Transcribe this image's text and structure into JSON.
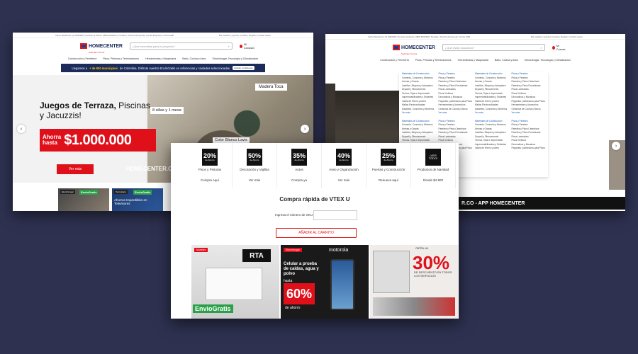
{
  "shot1": {
    "topline_left": "Venta Telefónica: (1) 6003300 | Servicio al cliente: 0800 6003300 | Tiendas | Servicio Empresas | Venta Empresa | Venta SAB",
    "topline_right": "Mis pedidos | Ayuda | Tiendas | Registro | Iniciar sesión",
    "logo": "HOMECENTER",
    "logo_sub": "Sodimac Corona",
    "search_placeholder": "¿Qué necesitas para tu proyecto?",
    "cart_label": "Mi Canasta",
    "nav": [
      "Construcción y Ferretería",
      "Pisos, Pinturas y Terminaciones",
      "Herramientas y Maquinaria",
      "Baño, Cocina y Aseo",
      "Electrohogar, Tecnología y Climatización"
    ],
    "promo_pre": "Llegamos a",
    "promo_highlight": "+ de 800 municipios",
    "promo_post": "de Colombia. Disfruta nuestro EnvíoGratis en referencias y ciudades seleccionadas.",
    "promo_pill": "Aplican condiciones",
    "hero_line1_bold": "Juegos de Terraza,",
    "hero_line1_rest": "Piscinas",
    "hero_line2": "y Jacuzzis!",
    "price_small_1": "Ahorra",
    "price_small_2": "hasta",
    "price_big": "$1.000.000",
    "hero_button": "Ver más",
    "tag_madera": "Madera Toca",
    "tag_sillas": "8 sillas y 1 mesa",
    "tag_color": "Color Blanco Lavis",
    "hero_brand": "HOMECENTER.CO",
    "tiles": [
      {
        "cat": "Electrohogar",
        "badge": "EnvioGratis",
        "text": ""
      },
      {
        "cat": "Tecnología",
        "badge": "EnvioGratis",
        "text": "Ahorros Imperdibles en Televisores"
      }
    ]
  },
  "shot2": {
    "topline_left": "Venta Telefónica: (1) 6003300 | Servicio al cliente: 0800 6003300 | Tiendas | Servicio Empresas | Venta SAB",
    "topline_right": "Mis pedidos | Ayuda | Tiendas | Registro | Iniciar sesión",
    "logo": "HOMECENTER",
    "logo_sub": "Sodimac Corona",
    "search_placeholder": "¿Qué estás buscando?",
    "cart_label": "Mi Cuenta",
    "nav": [
      "Construcción y Ferretería",
      "Pisos, Pinturas y Terminaciones",
      "Herramientas y Maquinaria",
      "Baño, Cocina y Aseo",
      "Electrohogar, Tecnología y Climatización"
    ],
    "menu_cols": [
      {
        "head": "Materiales de Construcción",
        "items": [
          "Cemento, Concreto y Morteros",
          "Arenas y Gravas",
          "Ladrillos, Bloques y Adoquines",
          "Drywall y Fibrocemento",
          "Techos, Tejas e Impermeab.",
          "Impermeabilizantes y Sellantes",
          "Varilla de Hierro y Acero",
          "Mallas Electrosoldadas",
          "Aislantes, Concretos y Morteros"
        ],
        "more": "Ver más"
      },
      {
        "head": "Pisos y Paredes",
        "items": [
          "Pisos y Paredes",
          "Paredes y Pisos Cerámicos",
          "Paredes y Pisos Porcelanato",
          "Pisos Laminados",
          "Pisos Vinílicos",
          "Decorativos y Mosaicos",
          "Pegantes y Adhesivos para Pisos",
          "Herramientas y Accesorios",
          "Cerámica de Cocina y Muros"
        ],
        "more": "Ver más"
      },
      {
        "head": "Materiales de Construcción",
        "items": [
          "Cemento, Concreto y Morteros",
          "Arenas y Gravas",
          "Ladrillos, Bloques y Adoquines",
          "Drywall y Fibrocemento",
          "Techos, Tejas e Impermeab.",
          "Impermeabilizantes y Sellantes",
          "Varilla de Hierro y Acero",
          "Mallas Electrosoldadas",
          "Aislantes, Concretos y Morteros"
        ],
        "more": "Ver más"
      },
      {
        "head": "Pisos y Paredes",
        "items": [
          "Pisos y Paredes",
          "Paredes y Pisos Cerámicos",
          "Paredes y Pisos Porcelanato",
          "Pisos Laminados",
          "Pisos Vinílicos",
          "Decorativos y Mosaicos",
          "Pegantes y Adhesivos para Pisos",
          "Herramientas y Accesorios",
          "Cerámica de Cocina y Muros"
        ],
        "more": "Ver más"
      }
    ],
    "app_bar": "R.CO - APP HOMECENTER"
  },
  "shot3": {
    "cats": [
      {
        "pct": "20%",
        "sub": "de Ahorro",
        "name": "Pisos y Pinturas",
        "link": "Compra Aquí"
      },
      {
        "pct": "50%",
        "sub": "de Ahorro",
        "name": "Decoración y Vajillas",
        "link": "Ver más"
      },
      {
        "pct": "35%",
        "sub": "de Ahorro",
        "name": "Autos",
        "link": "Compra ya"
      },
      {
        "pct": "40%",
        "sub": "de Ahorro",
        "name": "Aseo y Organización",
        "link": "Ver más"
      },
      {
        "pct": "25%",
        "sub": "de Ahorro",
        "name": "Puertas y Construcción",
        "link": "Renueva aquí"
      },
      {
        "pct": "¡VER",
        "sub": "TODO!",
        "name": "Productos de Navidad",
        "link": "Desde $4.900"
      }
    ],
    "vtex_title": "Compra rápida de VTEX U",
    "sku_label": "Ingresa el número de SKU",
    "add_button": "AÑADIR AL CARRITO",
    "banner1": {
      "cat": "Muebles",
      "brand": "RTA",
      "badge": "EnvioGratis"
    },
    "banner2": {
      "cat": "Electrohogar",
      "brand": "motorola",
      "text": "Celular a prueba de caídas, agua y polvo",
      "hasta": "hasta",
      "pct": "60%",
      "ahorro": "de ahorro"
    },
    "banner3": {
      "obten": "OBTÉN UN",
      "pct": "30%",
      "desc": "DE DESCUENTO EN TODOS LOS SERVICIOS"
    }
  }
}
